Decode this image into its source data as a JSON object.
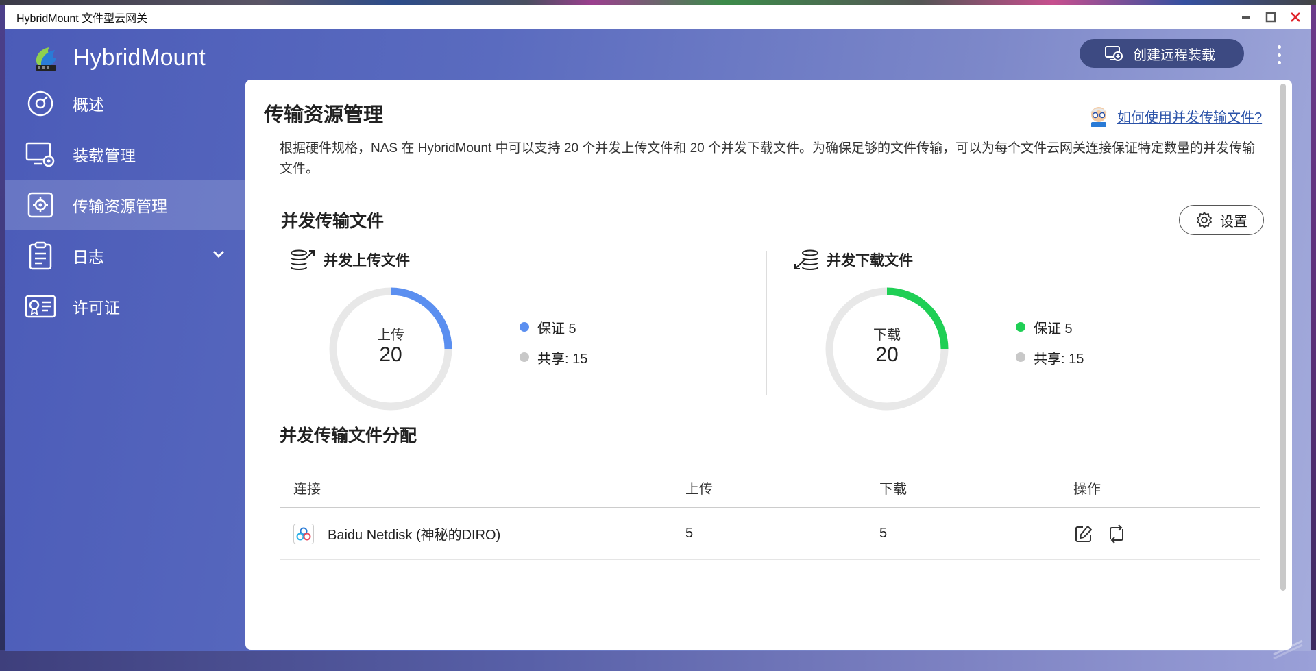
{
  "window": {
    "title": "HybridMount 文件型云网关"
  },
  "app": {
    "name": "HybridMount"
  },
  "header": {
    "create_button": "创建远程装载"
  },
  "sidebar": {
    "items": [
      {
        "label": "概述"
      },
      {
        "label": "装载管理"
      },
      {
        "label": "传输资源管理"
      },
      {
        "label": "日志"
      },
      {
        "label": "许可证"
      }
    ]
  },
  "page": {
    "title": "传输资源管理",
    "help_link": "如何使用并发传输文件?",
    "description": "根据硬件规格，NAS 在 HybridMount 中可以支持 20 个并发上传文件和 20 个并发下载文件。为确保足够的文件传输，可以为每个文件云网关连接保证特定数量的并发传输文件。"
  },
  "concurrent": {
    "title": "并发传输文件",
    "settings_button": "设置",
    "upload": {
      "title": "并发上传文件",
      "center_label": "上传",
      "total": "20",
      "guaranteed_label": "保证 5",
      "shared_label": "共享: 15",
      "guaranteed": 5,
      "shared": 15,
      "color": "#5b8ff0"
    },
    "download": {
      "title": "并发下载文件",
      "center_label": "下载",
      "total": "20",
      "guaranteed_label": "保证 5",
      "shared_label": "共享: 15",
      "guaranteed": 5,
      "shared": 15,
      "color": "#1fcf55"
    },
    "shared_color": "#c8c8c8"
  },
  "allocation": {
    "title": "并发传输文件分配",
    "columns": [
      "连接",
      "上传",
      "下载",
      "操作"
    ],
    "rows": [
      {
        "connection": "Baidu Netdisk (神秘的DIRO)",
        "upload": "5",
        "download": "5"
      }
    ]
  }
}
